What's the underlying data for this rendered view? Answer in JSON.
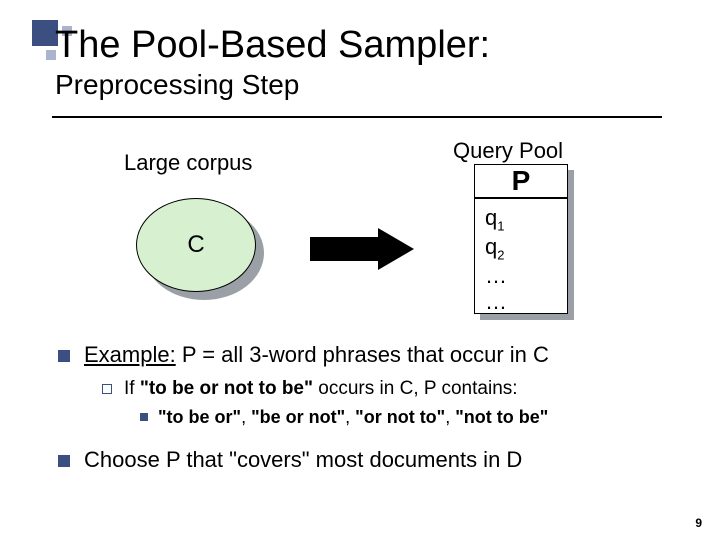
{
  "title": {
    "line1": "The Pool-Based Sampler:",
    "line2": "Preprocessing Step"
  },
  "diagram": {
    "large_corpus_label": "Large corpus",
    "query_pool_label": "Query Pool",
    "corpus_letter": "C",
    "pool_letter": "P",
    "pool_items": {
      "q1_base": "q",
      "q1_sub": "1",
      "q2_base": "q",
      "q2_sub": "2",
      "ell1": "…",
      "ell2": "…"
    }
  },
  "body": {
    "example_label": "Example:",
    "example_rest": " P = all 3-word phrases that occur in C",
    "if_pre": "If ",
    "if_phrase": "\"to be or not to be\"",
    "if_post": " occurs in C, P contains:",
    "phrases": {
      "p1": "\"to be or\"",
      "p2": "\"be or not\"",
      "p3": "\"or not to\"",
      "p4": "\"not to be\"",
      "sep": ",   "
    },
    "choose": "Choose P that \"covers\" most documents in D"
  },
  "page_number": "9"
}
